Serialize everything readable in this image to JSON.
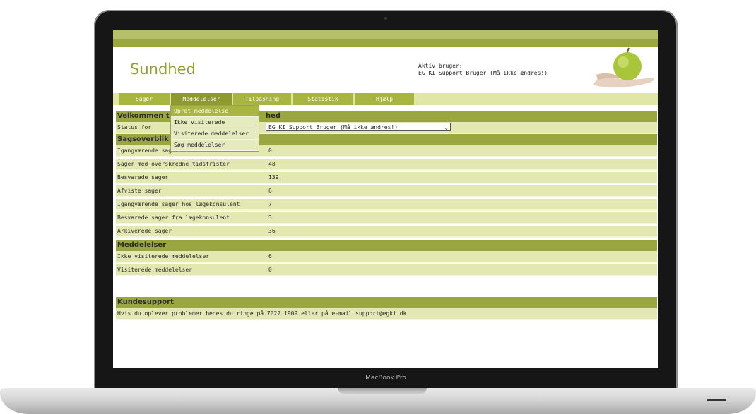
{
  "device": {
    "model_label": "MacBook Pro"
  },
  "header": {
    "app_title": "Sundhed",
    "active_user_label": "Aktiv bruger:",
    "active_user_name": "EG KI Support Bruger (Må ikke ændres!)"
  },
  "nav": {
    "tabs": [
      {
        "label": "Sager"
      },
      {
        "label": "Meddelelser"
      },
      {
        "label": "Tilpasning"
      },
      {
        "label": "Statistik"
      },
      {
        "label": "Hjælp"
      }
    ],
    "active_tab": "Meddelelser"
  },
  "dropdown": {
    "items": [
      {
        "label": "Opret meddelelse"
      },
      {
        "label": "Ikke visiterede"
      },
      {
        "label": "Visiterede meddelelser"
      },
      {
        "label": "Søg meddelelser"
      }
    ]
  },
  "welcome": {
    "heading_visible": "Velkommen t",
    "heading_tail": "hed",
    "status_label": "Status for",
    "status_select_value": "EG KI Support Bruger (Må ikke ændres!)"
  },
  "overview": {
    "heading": "Sagsoverblik",
    "rows": [
      {
        "label": "Igangværende sager",
        "value": "0"
      },
      {
        "label": "Sager med overskredne tidsfrister",
        "value": "48"
      },
      {
        "label": "Besvarede sager",
        "value": "139"
      },
      {
        "label": "Afviste sager",
        "value": "6"
      },
      {
        "label": "Igangværende sager hos lægekonsulent",
        "value": "7"
      },
      {
        "label": "Besvarede sager fra lægekonsulent",
        "value": "3"
      },
      {
        "label": "Arkiverede sager",
        "value": "36"
      }
    ]
  },
  "messages": {
    "heading": "Meddelelser",
    "rows": [
      {
        "label": "Ikke visiterede meddelelser",
        "value": "6"
      },
      {
        "label": "Visiterede meddelelser",
        "value": "0"
      }
    ]
  },
  "support": {
    "heading": "Kundesupport",
    "text": "Hvis du oplever problemer bedes du ringe på 7022 1909 eller på e-mail support@egki.dk"
  },
  "colors": {
    "accent": "#9aa740",
    "row_bg": "#e3e8b2",
    "title": "#90a132"
  }
}
